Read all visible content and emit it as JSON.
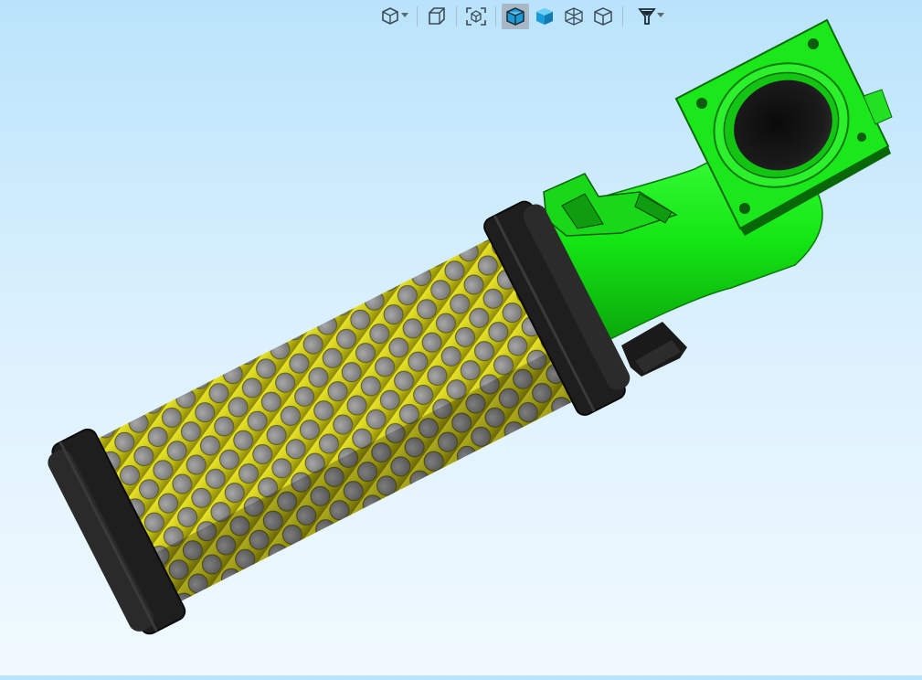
{
  "toolbar": {
    "buttons": [
      {
        "name": "view-orientation",
        "icon": "cube-orientation-icon",
        "has_dropdown": true,
        "active": false
      },
      {
        "name": "previous-view",
        "icon": "cube-previous-view-icon",
        "has_dropdown": false,
        "active": false
      },
      {
        "name": "zoom-to-fit",
        "icon": "zoom-to-fit-icon",
        "has_dropdown": false,
        "active": false
      },
      {
        "name": "shaded-with-edges",
        "icon": "shaded-with-edges-icon",
        "has_dropdown": false,
        "active": true
      },
      {
        "name": "shaded",
        "icon": "shaded-icon",
        "has_dropdown": false,
        "active": false
      },
      {
        "name": "wireframe",
        "icon": "wireframe-icon",
        "has_dropdown": false,
        "active": false
      },
      {
        "name": "hidden-lines-removed",
        "icon": "hidden-lines-removed-icon",
        "has_dropdown": false,
        "active": false
      },
      {
        "name": "filter",
        "icon": "filter-icon",
        "has_dropdown": true,
        "active": false
      }
    ]
  },
  "model": {
    "parts": [
      {
        "name": "filter-end-cap",
        "color": "#1c1c1c"
      },
      {
        "name": "perforated-filter-mesh",
        "color": "#c8c41a",
        "hole_color": "#8e8e8e"
      },
      {
        "name": "intake-elbow",
        "color": "#14e614"
      }
    ]
  },
  "colors": {
    "background_top": "#b9e3fb",
    "background_bottom": "#f1f9ff",
    "toolbar_icon": "#3c4a56",
    "toolbar_icon_accent": "#1a9ad6"
  }
}
